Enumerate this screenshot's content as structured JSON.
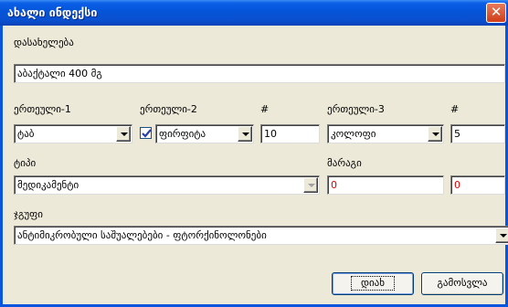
{
  "window": {
    "title": "ახალი ინდექსი",
    "close_glyph": "✕"
  },
  "labels": {
    "name": "დასახელება",
    "unit1": "ერთეული-1",
    "unit2": "ერთეული-2",
    "num1": "#",
    "unit3": "ერთეული-3",
    "num2": "#",
    "type": "ტიპი",
    "stock": "მარაგი",
    "group": "ჯგუფი"
  },
  "fields": {
    "name": "აბაქტალი 400 მგ",
    "unit1": "ტაბ",
    "unit2": "ფირფიტა",
    "unit2_checked": true,
    "num1": "10",
    "unit3": "კოლოფი",
    "num2": "5",
    "type": "მედიკამენტი",
    "stock1": "0",
    "stock2": "0",
    "group": "ანტიმიკრობული საშუალებები - ფტორქინოლონები"
  },
  "buttons": {
    "ok": "დიახ",
    "cancel": "გამოსვლა"
  },
  "colors": {
    "titlebar": "#0554d8",
    "close": "#cf3d18",
    "stock_value": "#e00000",
    "check": "#2a3ea8"
  },
  "icons": {
    "close": "close-icon",
    "dropdown": "chevron-down-icon",
    "check": "checkmark-icon"
  }
}
